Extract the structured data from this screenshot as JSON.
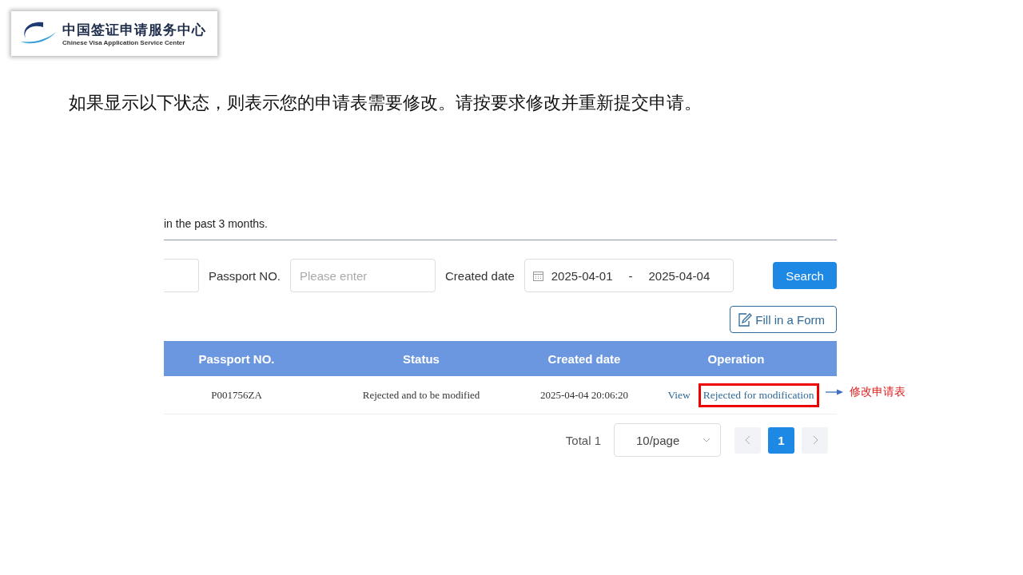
{
  "logo": {
    "title_zh": "中国签证申请服务中心",
    "title_en": "Chinese Visa Application Service Center"
  },
  "heading": "如果显示以下状态，则表示您的申请表需要修改。请按要求修改并重新提交申请。",
  "screenshot": {
    "notice": "in the past 3 months.",
    "filters": {
      "passport_label": "Passport NO.",
      "passport_placeholder": "Please enter",
      "date_label": "Created date",
      "date_from": "2025-04-01",
      "date_separator": "-",
      "date_to": "2025-04-04"
    },
    "search_button": "Search",
    "fill_button": "Fill in a Form",
    "table": {
      "columns": [
        "Passport NO.",
        "Status",
        "Created date",
        "Operation"
      ],
      "rows": [
        {
          "cells": [
            "P001756ZA",
            "Rejected and to be modified",
            "2025-04-04 20:06:20"
          ],
          "actions": [
            {
              "label": "View",
              "highlighted": false
            },
            {
              "label": "Rejected for modification",
              "highlighted": true
            }
          ]
        }
      ]
    },
    "pagination": {
      "total": "Total 1",
      "page_size": "10/page",
      "pages": [
        {
          "label": "1",
          "selected": true
        }
      ]
    }
  },
  "annotation": "修改申请表"
}
